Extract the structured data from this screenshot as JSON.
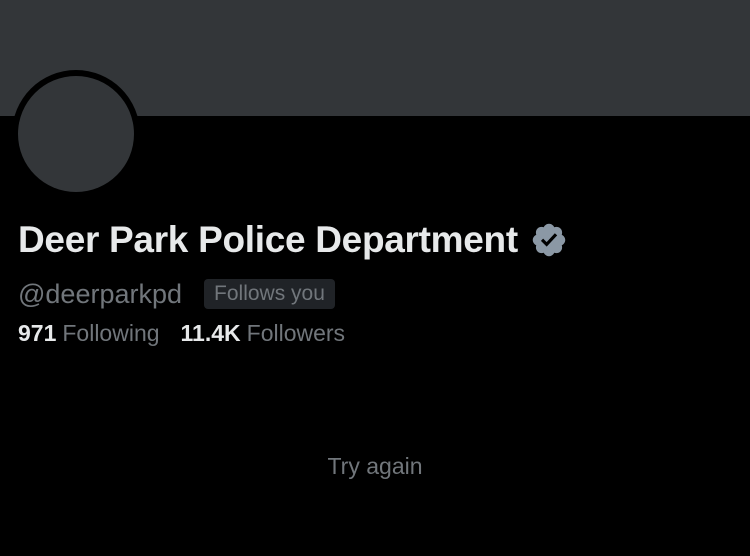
{
  "profile": {
    "display_name": "Deer Park Police Department",
    "verified_badge_icon": "verified-badge-icon",
    "verified_color": "#8b98a5",
    "handle": "@deerparkpd",
    "follows_you_label": "Follows you"
  },
  "stats": {
    "following_count": "971",
    "following_label": "Following",
    "followers_count": "11.4K",
    "followers_label": "Followers"
  },
  "feed": {
    "try_again_label": "Try again"
  },
  "colors": {
    "background": "#000000",
    "banner": "#333639",
    "primary_text": "#e7e9ea",
    "secondary_text": "#71767b",
    "badge_bg": "#202327"
  }
}
